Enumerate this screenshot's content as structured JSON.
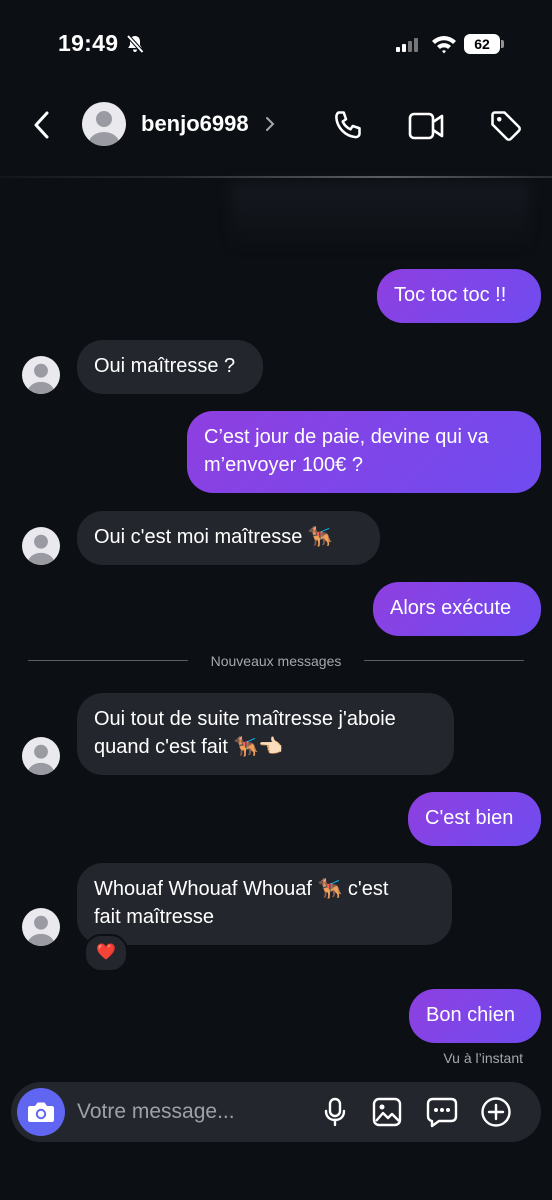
{
  "status_bar": {
    "time": "19:49",
    "battery": "62"
  },
  "header": {
    "username": "benjo6998"
  },
  "messages": [
    {
      "text": "Toc toc toc !!"
    },
    {
      "text": "Oui maîtresse ?"
    },
    {
      "text": "C’est jour de paie, devine qui va\nm’envoyer 100€ ?"
    },
    {
      "text": "Oui c'est moi maîtresse 🐕‍🦺"
    },
    {
      "text": "Alors exécute"
    },
    {
      "text": "Oui tout de suite maîtresse j'aboie\nquand c'est fait 🐕‍🦺👈🏻"
    },
    {
      "text": "C'est bien"
    },
    {
      "text": "Whouaf Whouaf Whouaf 🐕‍🦺 c'est\nfait maîtresse"
    },
    {
      "text": "Bon chien"
    }
  ],
  "divider": {
    "label": "Nouveaux messages"
  },
  "reaction": {
    "emoji": "❤️"
  },
  "seen": {
    "label": "Vu à l’instant"
  },
  "composer": {
    "placeholder": "Votre message..."
  },
  "colors": {
    "background": "#0c0f14",
    "outgoing_start": "#8f3fe0",
    "outgoing_end": "#6f4cf0",
    "incoming": "#23262d",
    "camera": "#6066f2"
  },
  "icons": [
    "bell-slash-icon",
    "signal-icon",
    "wifi-icon",
    "battery-icon",
    "back-arrow-icon",
    "chevron-right-icon",
    "phone-icon",
    "video-camera-icon",
    "tag-icon",
    "camera-icon",
    "microphone-icon",
    "image-icon",
    "sticker-icon",
    "plus-icon"
  ]
}
